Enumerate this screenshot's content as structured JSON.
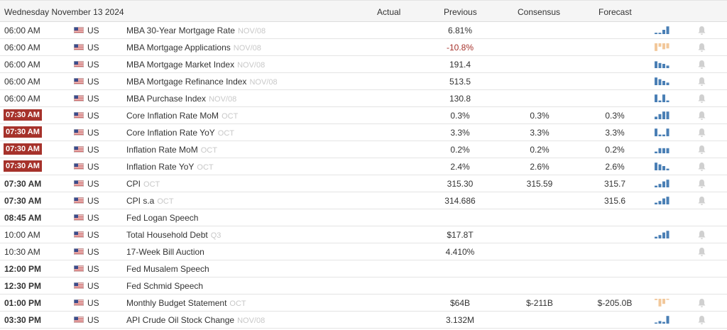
{
  "header": {
    "date": "Wednesday November 13 2024",
    "actual": "Actual",
    "previous": "Previous",
    "consensus": "Consensus",
    "forecast": "Forecast"
  },
  "colors": {
    "highlight": "#a6322b",
    "spark_blue": "#4a7fb5",
    "spark_orange": "#f2c89b",
    "bell": "#d0d0d0"
  },
  "rows": [
    {
      "time": "06:00 AM",
      "style": "normal",
      "country": "US",
      "event": "MBA 30-Year Mortgage Rate",
      "period": "NOV/08",
      "previous": "6.81%",
      "consensus": "",
      "forecast": "",
      "spark": {
        "color": "blue",
        "bars": [
          0.15,
          0.15,
          0.5,
          0.9
        ]
      },
      "bell": true
    },
    {
      "time": "06:00 AM",
      "style": "normal",
      "country": "US",
      "event": "MBA Mortgage Applications",
      "period": "NOV/08",
      "previous": "-10.8%",
      "previous_neg": true,
      "consensus": "",
      "forecast": "",
      "spark": {
        "color": "orange",
        "bars": [
          0.9,
          0.4,
          0.7,
          0.6
        ]
      },
      "bell": true
    },
    {
      "time": "06:00 AM",
      "style": "normal",
      "country": "US",
      "event": "MBA Mortgage Market Index",
      "period": "NOV/08",
      "previous": "191.4",
      "consensus": "",
      "forecast": "",
      "spark": {
        "color": "blue",
        "bars": [
          0.8,
          0.6,
          0.5,
          0.3
        ]
      },
      "bell": true
    },
    {
      "time": "06:00 AM",
      "style": "normal",
      "country": "US",
      "event": "MBA Mortgage Refinance Index",
      "period": "NOV/08",
      "previous": "513.5",
      "consensus": "",
      "forecast": "",
      "spark": {
        "color": "blue",
        "bars": [
          0.9,
          0.7,
          0.5,
          0.3
        ]
      },
      "bell": true
    },
    {
      "time": "06:00 AM",
      "style": "normal",
      "country": "US",
      "event": "MBA Purchase Index",
      "period": "NOV/08",
      "previous": "130.8",
      "consensus": "",
      "forecast": "",
      "spark": {
        "color": "blue",
        "bars": [
          0.9,
          0.2,
          0.9,
          0.2
        ]
      },
      "bell": true
    },
    {
      "time": "07:30 AM",
      "style": "highlight",
      "country": "US",
      "event": "Core Inflation Rate MoM",
      "period": "OCT",
      "previous": "0.3%",
      "consensus": "0.3%",
      "forecast": "0.3%",
      "spark": {
        "color": "blue",
        "bars": [
          0.3,
          0.6,
          0.9,
          0.9
        ]
      },
      "bell": true
    },
    {
      "time": "07:30 AM",
      "style": "highlight",
      "country": "US",
      "event": "Core Inflation Rate YoY",
      "period": "OCT",
      "previous": "3.3%",
      "consensus": "3.3%",
      "forecast": "3.3%",
      "spark": {
        "color": "blue",
        "bars": [
          0.9,
          0.2,
          0.2,
          0.9
        ]
      },
      "bell": true
    },
    {
      "time": "07:30 AM",
      "style": "highlight",
      "country": "US",
      "event": "Inflation Rate MoM",
      "period": "OCT",
      "previous": "0.2%",
      "consensus": "0.2%",
      "forecast": "0.2%",
      "spark": {
        "color": "blue",
        "bars": [
          0.2,
          0.6,
          0.6,
          0.6
        ]
      },
      "bell": true
    },
    {
      "time": "07:30 AM",
      "style": "highlight",
      "country": "US",
      "event": "Inflation Rate YoY",
      "period": "OCT",
      "previous": "2.4%",
      "consensus": "2.6%",
      "forecast": "2.6%",
      "spark": {
        "color": "blue",
        "bars": [
          0.9,
          0.7,
          0.5,
          0.2
        ]
      },
      "bell": true
    },
    {
      "time": "07:30 AM",
      "style": "bold",
      "country": "US",
      "event": "CPI",
      "period": "OCT",
      "previous": "315.30",
      "consensus": "315.59",
      "forecast": "315.7",
      "spark": {
        "color": "blue",
        "bars": [
          0.2,
          0.4,
          0.7,
          0.9
        ]
      },
      "bell": true
    },
    {
      "time": "07:30 AM",
      "style": "bold",
      "country": "US",
      "event": "CPI s.a",
      "period": "OCT",
      "previous": "314.686",
      "consensus": "",
      "forecast": "315.6",
      "spark": {
        "color": "blue",
        "bars": [
          0.2,
          0.4,
          0.7,
          0.9
        ]
      },
      "bell": true
    },
    {
      "time": "08:45 AM",
      "style": "bold",
      "country": "US",
      "event": "Fed Logan Speech",
      "period": "",
      "previous": "",
      "consensus": "",
      "forecast": "",
      "spark": null,
      "bell": false
    },
    {
      "time": "10:00 AM",
      "style": "normal",
      "country": "US",
      "event": "Total Household Debt",
      "period": "Q3",
      "previous": "$17.8T",
      "consensus": "",
      "forecast": "",
      "spark": {
        "color": "blue",
        "bars": [
          0.2,
          0.4,
          0.7,
          0.9
        ]
      },
      "bell": true
    },
    {
      "time": "10:30 AM",
      "style": "normal",
      "country": "US",
      "event": "17-Week Bill Auction",
      "period": "",
      "previous": "4.410%",
      "consensus": "",
      "forecast": "",
      "spark": null,
      "bell": true
    },
    {
      "time": "12:00 PM",
      "style": "bold",
      "country": "US",
      "event": "Fed Musalem Speech",
      "period": "",
      "previous": "",
      "consensus": "",
      "forecast": "",
      "spark": null,
      "bell": false
    },
    {
      "time": "12:30 PM",
      "style": "bold",
      "country": "US",
      "event": "Fed Schmid Speech",
      "period": "",
      "previous": "",
      "consensus": "",
      "forecast": "",
      "spark": null,
      "bell": false
    },
    {
      "time": "01:00 PM",
      "style": "bold",
      "country": "US",
      "event": "Monthly Budget Statement",
      "period": "OCT",
      "previous": "$64B",
      "consensus": "$-211B",
      "forecast": "$-205.0B",
      "spark": {
        "color": "orange",
        "bars": [
          0.15,
          0.9,
          0.6,
          0.1
        ]
      },
      "bell": true
    },
    {
      "time": "03:30 PM",
      "style": "bold",
      "country": "US",
      "event": "API Crude Oil Stock Change",
      "period": "NOV/08",
      "previous": "3.132M",
      "consensus": "",
      "forecast": "",
      "spark": {
        "color": "blue",
        "bars": [
          0.1,
          0.3,
          0.2,
          0.9
        ]
      },
      "bell": true
    }
  ]
}
